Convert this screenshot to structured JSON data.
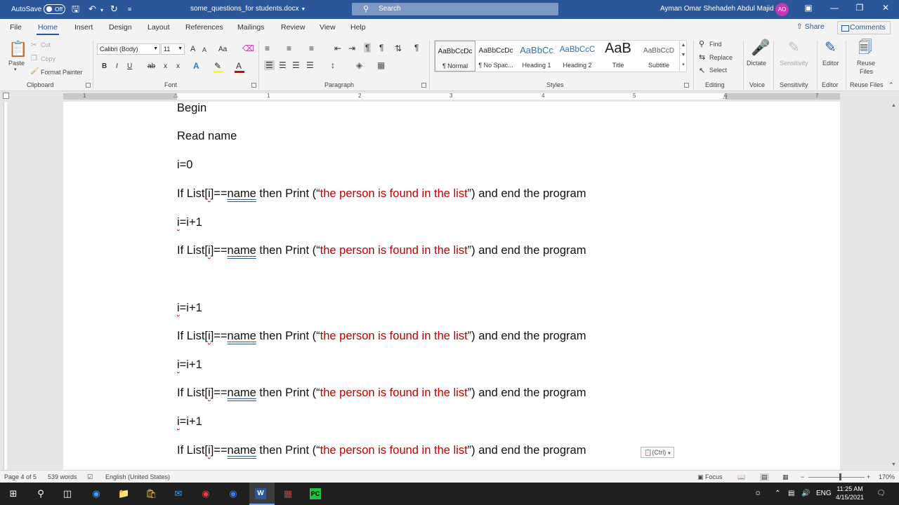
{
  "titlebar": {
    "autosave_label": "AutoSave",
    "autosave_state": "Off",
    "document_name": "some_questions_for students.docx",
    "search_placeholder": "Search",
    "user_name": "Ayman Omar Shehadeh Abdul Majid",
    "user_initials": "AO"
  },
  "menu": {
    "tabs": [
      "File",
      "Home",
      "Insert",
      "Design",
      "Layout",
      "References",
      "Mailings",
      "Review",
      "View",
      "Help"
    ],
    "active_tab": "Home",
    "share_label": "Share",
    "comments_label": "Comments"
  },
  "ribbon": {
    "clipboard": {
      "group_label": "Clipboard",
      "paste_label": "Paste",
      "cut_label": "Cut",
      "copy_label": "Copy",
      "format_painter_label": "Format Painter"
    },
    "font": {
      "group_label": "Font",
      "font_name": "Calibri (Body)",
      "font_size": "11",
      "grow": "A",
      "shrink": "A",
      "case": "Aa",
      "bold": "B",
      "italic": "I",
      "underline": "U",
      "strike": "ab",
      "subscript": "x",
      "superscript": "x",
      "text_effects": "A",
      "font_color": "A"
    },
    "paragraph": {
      "group_label": "Paragraph",
      "pilcrow": "¶"
    },
    "styles": {
      "group_label": "Styles",
      "items": [
        {
          "preview": "AaBbCcDc",
          "name": "¶ Normal"
        },
        {
          "preview": "AaBbCcDc",
          "name": "¶ No Spac..."
        },
        {
          "preview": "AaBbCc",
          "name": "Heading 1"
        },
        {
          "preview": "AaBbCcC",
          "name": "Heading 2"
        },
        {
          "preview": "AaB",
          "name": "Title"
        },
        {
          "preview": "AaBbCcD",
          "name": "Subtitle"
        }
      ]
    },
    "editing": {
      "group_label": "Editing",
      "find_label": "Find",
      "replace_label": "Replace",
      "select_label": "Select"
    },
    "voice": {
      "group_label": "Voice",
      "dictate_label": "Dictate"
    },
    "sensitivity": {
      "group_label": "Sensitivity",
      "button_label": "Sensitivity"
    },
    "editor": {
      "group_label": "Editor",
      "button_label": "Editor"
    },
    "reuse": {
      "group_label": "Reuse Files",
      "button_line1": "Reuse",
      "button_line2": "Files"
    }
  },
  "ruler": {
    "numbers": [
      "1",
      "1",
      "2",
      "3",
      "4",
      "5",
      "6",
      "7"
    ]
  },
  "document": {
    "begin": "Begin",
    "read_name": "Read name",
    "init_i": "i=0",
    "if_prefix": "If List[",
    "if_index": "i",
    "if_mid": "]==",
    "if_name": "name",
    "if_then": " then Print (“",
    "if_red": "the person is found in the list",
    "if_suffix": "”) and end the program",
    "increment_i": "i",
    "increment_rest": "=i+1",
    "paste_options": "(Ctrl)"
  },
  "status": {
    "page": "Page 4 of 5",
    "words": "539 words",
    "language": "English (United States)",
    "focus_label": "Focus",
    "zoom": "170%"
  },
  "taskbar": {
    "language": "ENG",
    "time": "11:25 AM",
    "date": "4/15/2021"
  }
}
